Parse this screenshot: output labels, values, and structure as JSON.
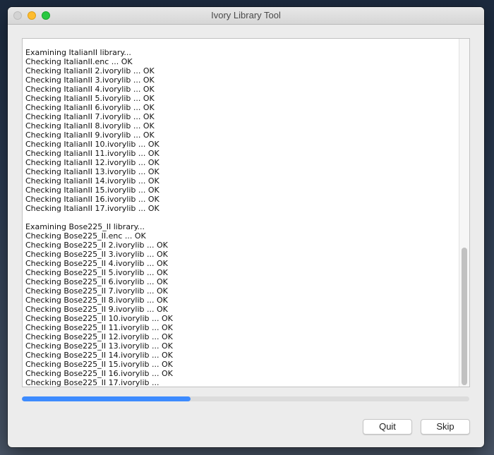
{
  "window": {
    "title": "Ivory Library Tool"
  },
  "log": {
    "lines": [
      "Examining ItalianII library...",
      "Checking ItalianII.enc ... OK",
      "Checking ItalianII 2.ivorylib ... OK",
      "Checking ItalianII 3.ivorylib ... OK",
      "Checking ItalianII 4.ivorylib ... OK",
      "Checking ItalianII 5.ivorylib ... OK",
      "Checking ItalianII 6.ivorylib ... OK",
      "Checking ItalianII 7.ivorylib ... OK",
      "Checking ItalianII 8.ivorylib ... OK",
      "Checking ItalianII 9.ivorylib ... OK",
      "Checking ItalianII 10.ivorylib ... OK",
      "Checking ItalianII 11.ivorylib ... OK",
      "Checking ItalianII 12.ivorylib ... OK",
      "Checking ItalianII 13.ivorylib ... OK",
      "Checking ItalianII 14.ivorylib ... OK",
      "Checking ItalianII 15.ivorylib ... OK",
      "Checking ItalianII 16.ivorylib ... OK",
      "Checking ItalianII 17.ivorylib ... OK",
      "",
      "Examining Bose225_II library...",
      "Checking Bose225_II.enc ... OK",
      "Checking Bose225_II 2.ivorylib ... OK",
      "Checking Bose225_II 3.ivorylib ... OK",
      "Checking Bose225_II 4.ivorylib ... OK",
      "Checking Bose225_II 5.ivorylib ... OK",
      "Checking Bose225_II 6.ivorylib ... OK",
      "Checking Bose225_II 7.ivorylib ... OK",
      "Checking Bose225_II 8.ivorylib ... OK",
      "Checking Bose225_II 9.ivorylib ... OK",
      "Checking Bose225_II 10.ivorylib ... OK",
      "Checking Bose225_II 11.ivorylib ... OK",
      "Checking Bose225_II 12.ivorylib ... OK",
      "Checking Bose225_II 13.ivorylib ... OK",
      "Checking Bose225_II 14.ivorylib ... OK",
      "Checking Bose225_II 15.ivorylib ... OK",
      "Checking Bose225_II 16.ivorylib ... OK",
      "Checking Bose225_II 17.ivorylib ..."
    ]
  },
  "progress": {
    "fraction": 0.377,
    "color": "#3d8bff"
  },
  "buttons": {
    "quit_label": "Quit",
    "skip_label": "Skip"
  }
}
